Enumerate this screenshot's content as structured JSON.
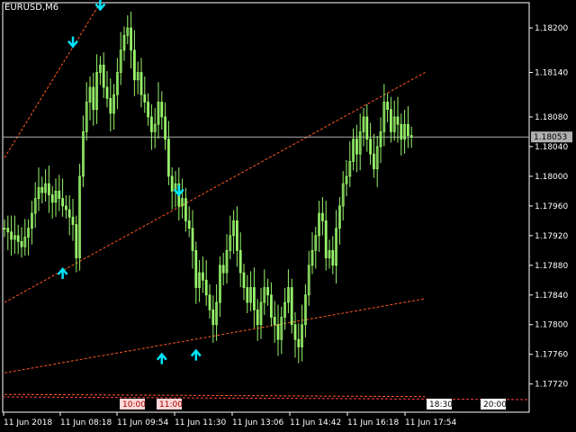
{
  "symbol_label": "EURUSD,M6",
  "colors": {
    "background": "#000000",
    "frame": "#ffffff",
    "candle": "#98f56a",
    "trendline": "#ff5a1e",
    "arrow": "#00e5ff",
    "current_price_line": "#b0b0b0",
    "current_price_box": "#b0b0b0",
    "session_line": "#ff4040",
    "session_label_bg": "#ffd6d6",
    "time_label_bg": "#ffffff"
  },
  "chart_data": {
    "type": "candlestick",
    "title": "EURUSD,M6",
    "y_ticks": [
      "1.18200",
      "1.18140",
      "1.18080",
      "1.18040",
      "1.18000",
      "1.17960",
      "1.17920",
      "1.17880",
      "1.17840",
      "1.17800",
      "1.17760",
      "1.17720"
    ],
    "y_tick_values": [
      1.182,
      1.1814,
      1.1808,
      1.1804,
      1.18,
      1.1796,
      1.1792,
      1.1788,
      1.1784,
      1.178,
      1.1776,
      1.1772
    ],
    "ylim": [
      1.17682,
      1.18234
    ],
    "x_ticks": [
      "11 Jun 2018",
      "11 Jun 08:18",
      "11 Jun 09:54",
      "11 Jun 11:30",
      "11 Jun 13:06",
      "11 Jun 14:42",
      "11 Jun 16:18",
      "11 Jun 17:54"
    ],
    "current_price": "1.18053",
    "current_price_value": 1.18053,
    "session_labels": [
      "10:00",
      "11:00"
    ],
    "time_labels": [
      "18:30",
      "20:00"
    ],
    "series_closes": [
      1.1793,
      1.17925,
      1.17915,
      1.1792,
      1.17912,
      1.17905,
      1.17918,
      1.1793,
      1.1795,
      1.1797,
      1.17985,
      1.17978,
      1.1799,
      1.17975,
      1.17965,
      1.1798,
      1.1797,
      1.1796,
      1.17955,
      1.17945,
      1.17935,
      1.1789,
      1.18,
      1.1806,
      1.181,
      1.1812,
      1.1809,
      1.1814,
      1.1815,
      1.1812,
      1.18105,
      1.18085,
      1.1811,
      1.1814,
      1.1817,
      1.1819,
      1.182,
      1.1817,
      1.1813,
      1.1814,
      1.1811,
      1.181,
      1.1808,
      1.1806,
      1.1807,
      1.181,
      1.1808,
      1.1805,
      1.18,
      1.1798,
      1.1799,
      1.1796,
      1.1797,
      1.1794,
      1.1793,
      1.179,
      1.1785,
      1.1787,
      1.1786,
      1.1784,
      1.1782,
      1.178,
      1.1783,
      1.1788,
      1.1787,
      1.179,
      1.1792,
      1.1794,
      1.179,
      1.1787,
      1.1785,
      1.1783,
      1.1785,
      1.1782,
      1.178,
      1.1783,
      1.1785,
      1.1784,
      1.1781,
      1.178,
      1.1778,
      1.1781,
      1.1783,
      1.1785,
      1.178,
      1.1778,
      1.1777,
      1.178,
      1.1784,
      1.1788,
      1.179,
      1.1792,
      1.1795,
      1.1794,
      1.1789,
      1.179,
      1.1788,
      1.1793,
      1.1796,
      1.1799,
      1.18,
      1.1802,
      1.1805,
      1.1803,
      1.1806,
      1.1808,
      1.1805,
      1.1803,
      1.1801,
      1.1804,
      1.1806,
      1.181,
      1.1809,
      1.1806,
      1.1808,
      1.1807,
      1.1805,
      1.1807,
      1.18055,
      1.18053
    ],
    "trendlines": [
      {
        "x0": 0,
        "y0": 1.18025,
        "x1": 28,
        "y1": 1.18234
      },
      {
        "x0": 0,
        "y0": 1.1783,
        "x1": 123,
        "y1": 1.1814
      },
      {
        "x0": 0,
        "y0": 1.17735,
        "x1": 123,
        "y1": 1.17835
      },
      {
        "x0": 0,
        "y0": 1.17706,
        "x1": 123,
        "y1": 1.17703
      }
    ],
    "arrows_down": [
      {
        "i": 20,
        "price": 1.18175
      },
      {
        "i": 28,
        "price": 1.18225
      },
      {
        "i": 51,
        "price": 1.17975
      }
    ],
    "arrows_up": [
      {
        "i": 17,
        "price": 1.17875
      },
      {
        "i": 46,
        "price": 1.1776
      },
      {
        "i": 56,
        "price": 1.17765
      }
    ]
  }
}
